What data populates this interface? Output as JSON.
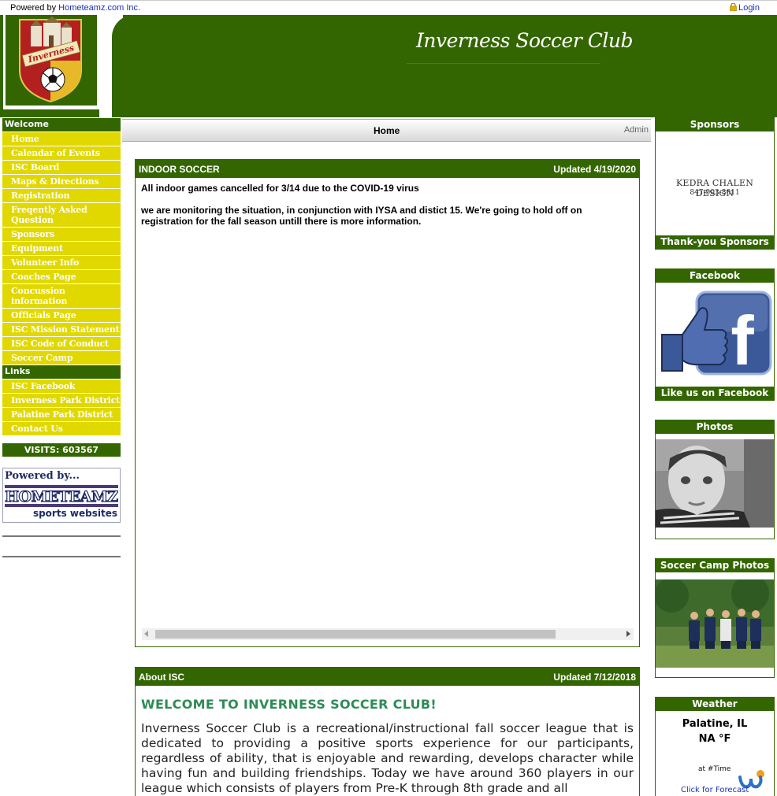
{
  "topbar": {
    "powered_prefix": "Powered by ",
    "powered_link": "Hometeamz.com Inc.",
    "login": "Login",
    "login_icon": "lock-icon"
  },
  "header": {
    "title": "Inverness Soccer Club",
    "logo_text": "Inverness",
    "background_color": "#336600"
  },
  "leftnav": {
    "welcome_header": "Welcome",
    "welcome_items": [
      "Home",
      "Calendar of Events",
      "ISC Board",
      "Maps & Directions",
      "Registration",
      "Freqently Asked Question",
      "Sponsors",
      "Equipment",
      "Volunteer Info",
      "Coaches Page",
      "Concussion information",
      "Officials Page",
      "ISC Mission Statement",
      "ISC Code of Conduct",
      "Soccer Camp"
    ],
    "links_header": "Links",
    "links_items": [
      "ISC Facebook",
      "Inverness Park District",
      "Palatine Park District",
      "Contact Us"
    ],
    "visits": "VISITS: 603567",
    "badge_line1": "Powered by...",
    "badge_logo": "HOMETEAMZ",
    "badge_line2": "sports websites",
    "item_color": "#e1d800"
  },
  "navbar": {
    "home": "Home",
    "admin": "Admin"
  },
  "panels": {
    "indoor": {
      "title": "INDOOR SOCCER",
      "updated": "Updated 4/19/2020",
      "line1": "All indoor games cancelled for 3/14 due to the COVID-19 virus",
      "line2": "we are monitoring the situation, in conjunction with IYSA and distict 15.  We're going to hold off on registration for the fall season untill there is more information."
    },
    "about": {
      "title": "About ISC",
      "updated": "Updated 7/12/2018",
      "heading": "WELCOME TO INVERNESS SOCCER CLUB!",
      "text": "Inverness Soccer Club is a recreational/instructional fall soccer league that is dedicated to providing a positive sports experience for our participants, regardless of ability, that is enjoyable and rewarding, develops character while having fun and building friendships. Today we have around 360 players in our league which consists of players from Pre-K through 8th grade and all"
    }
  },
  "rightcol": {
    "sponsors_title": "Sponsors",
    "sponsor_name": "KEDRA CHALEN DESIGN",
    "sponsor_phone": "847-903-8011",
    "sponsors_footer": "Thank-you Sponsors",
    "facebook_title": "Facebook",
    "facebook_footer": "Like us on Facebook",
    "photos_title": "Photos",
    "camp_title": "Soccer Camp Photos",
    "weather_title": "Weather",
    "weather_city": "Palatine, IL",
    "weather_temp": "NA °F",
    "weather_time": "at #Time",
    "weather_forecast": "Click for Forecast"
  }
}
